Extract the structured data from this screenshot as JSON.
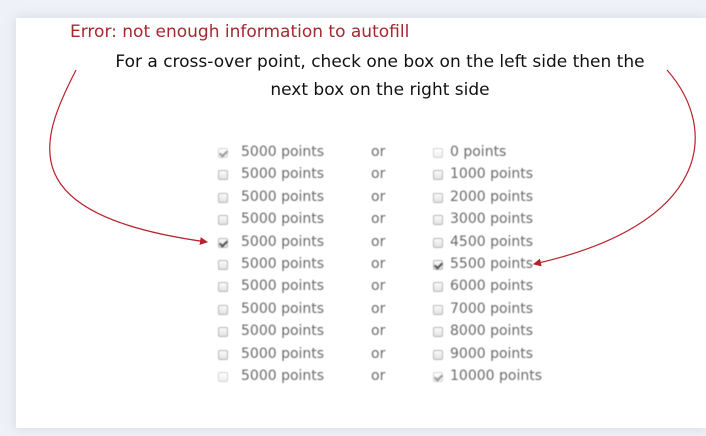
{
  "annotation": {
    "error_text": "Error: not enough information to autofill",
    "instruction_line1": "For a cross-over point, check one box on the left side then the",
    "instruction_line2": "next box on the right side",
    "arrow_color": "#b8202a"
  },
  "form": {
    "or_label": "or",
    "rows": [
      {
        "left": "5000 points",
        "right": "0 points",
        "left_checked": true,
        "right_checked": false,
        "left_faint": true,
        "right_faint": true
      },
      {
        "left": "5000 points",
        "right": "1000 points",
        "left_checked": false,
        "right_checked": false,
        "left_faint": false,
        "right_faint": false
      },
      {
        "left": "5000 points",
        "right": "2000 points",
        "left_checked": false,
        "right_checked": false,
        "left_faint": false,
        "right_faint": false
      },
      {
        "left": "5000 points",
        "right": "3000 points",
        "left_checked": false,
        "right_checked": false,
        "left_faint": false,
        "right_faint": false
      },
      {
        "left": "5000 points",
        "right": "4500 points",
        "left_checked": true,
        "right_checked": false,
        "left_faint": false,
        "right_faint": false
      },
      {
        "left": "5000 points",
        "right": "5500 points",
        "left_checked": false,
        "right_checked": true,
        "left_faint": false,
        "right_faint": false
      },
      {
        "left": "5000 points",
        "right": "6000 points",
        "left_checked": false,
        "right_checked": false,
        "left_faint": false,
        "right_faint": false
      },
      {
        "left": "5000 points",
        "right": "7000 points",
        "left_checked": false,
        "right_checked": false,
        "left_faint": false,
        "right_faint": false
      },
      {
        "left": "5000 points",
        "right": "8000 points",
        "left_checked": false,
        "right_checked": false,
        "left_faint": false,
        "right_faint": false
      },
      {
        "left": "5000 points",
        "right": "9000 points",
        "left_checked": false,
        "right_checked": false,
        "left_faint": false,
        "right_faint": false
      },
      {
        "left": "5000 points",
        "right": "10000 points",
        "left_checked": false,
        "right_checked": true,
        "left_faint": true,
        "right_faint": true
      }
    ]
  }
}
